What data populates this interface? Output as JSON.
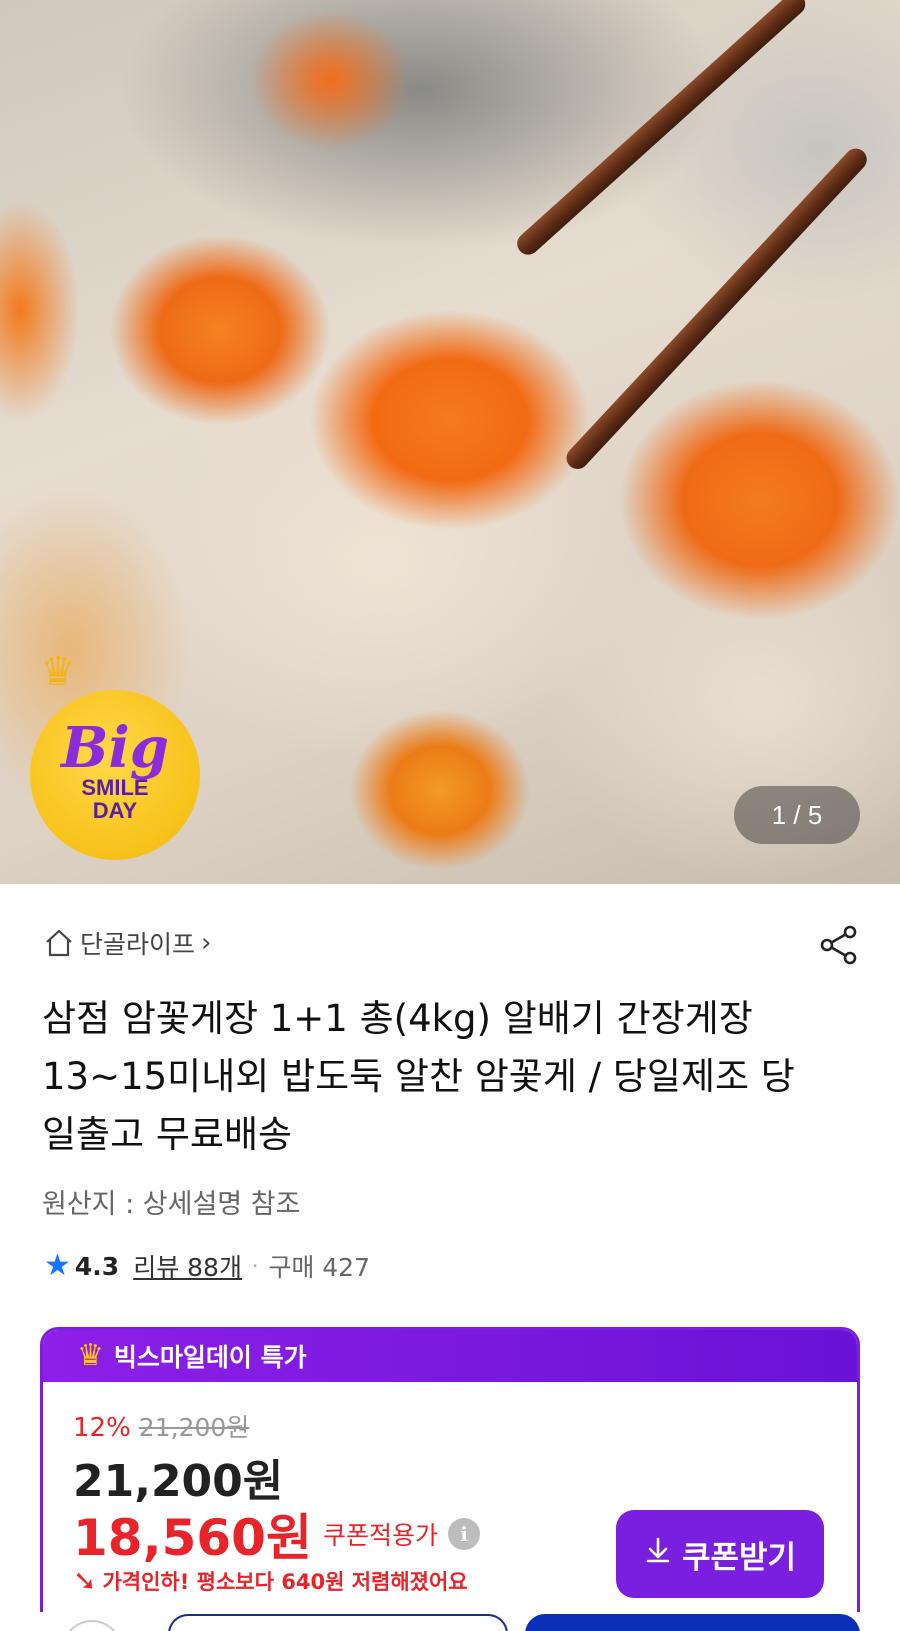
{
  "hero": {
    "pager": "1 / 5",
    "promo_badge": {
      "big": "Big",
      "line1": "SMILE",
      "line2": "DAY"
    }
  },
  "store": {
    "name": "단골라이프",
    "chevron": "›"
  },
  "product": {
    "title": "삼점 암꽃게장 1+1 총(4kg) 알배기 간장게장 13~15미내외 밥도둑 알찬 암꽃게 / 당일제조 당일출고 무료배송",
    "origin": "원산지 : 상세설명 참조"
  },
  "rating": {
    "score": "4.3",
    "reviews": "리뷰 88개",
    "separator": "·",
    "purchases": "구매 427"
  },
  "deal": {
    "header": "빅스마일데이 특가",
    "discount": "12%",
    "original_price": "21,200원",
    "sale_price": "21,200원",
    "coupon_price": "18,560원",
    "coupon_label": "쿠폰적용가",
    "notice": "가격인하! 평소보다 640원 저렴해졌어요",
    "coupon_button": "쿠폰받기"
  },
  "colors": {
    "accent_purple": "#7a1fe0",
    "price_red": "#e8242a",
    "star_blue": "#1a73ff",
    "bottom_blue": "#0c2fb8"
  },
  "icons": {
    "home": "home-icon",
    "share": "share-icon",
    "star": "star-icon",
    "crown": "crown-icon",
    "info": "info-icon",
    "download": "download-icon",
    "price_down": "arrow-down-icon"
  }
}
